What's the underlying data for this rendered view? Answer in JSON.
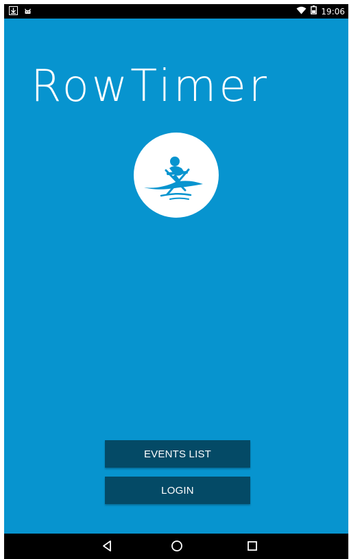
{
  "status_bar": {
    "time": "19:06",
    "icons": [
      "download-notification-icon",
      "android-notification-icon",
      "wifi-icon",
      "battery-icon"
    ]
  },
  "app": {
    "title": "RowTimer",
    "logo": "rowing-logo-icon"
  },
  "buttons": {
    "events_list": "EVENTS LIST",
    "login": "LOGIN"
  },
  "navigation": {
    "items": [
      "back-icon",
      "home-icon",
      "recents-icon"
    ]
  },
  "colors": {
    "background": "#0794cf",
    "button": "#044a66",
    "text": "#ffffff",
    "bars": "#000000"
  }
}
